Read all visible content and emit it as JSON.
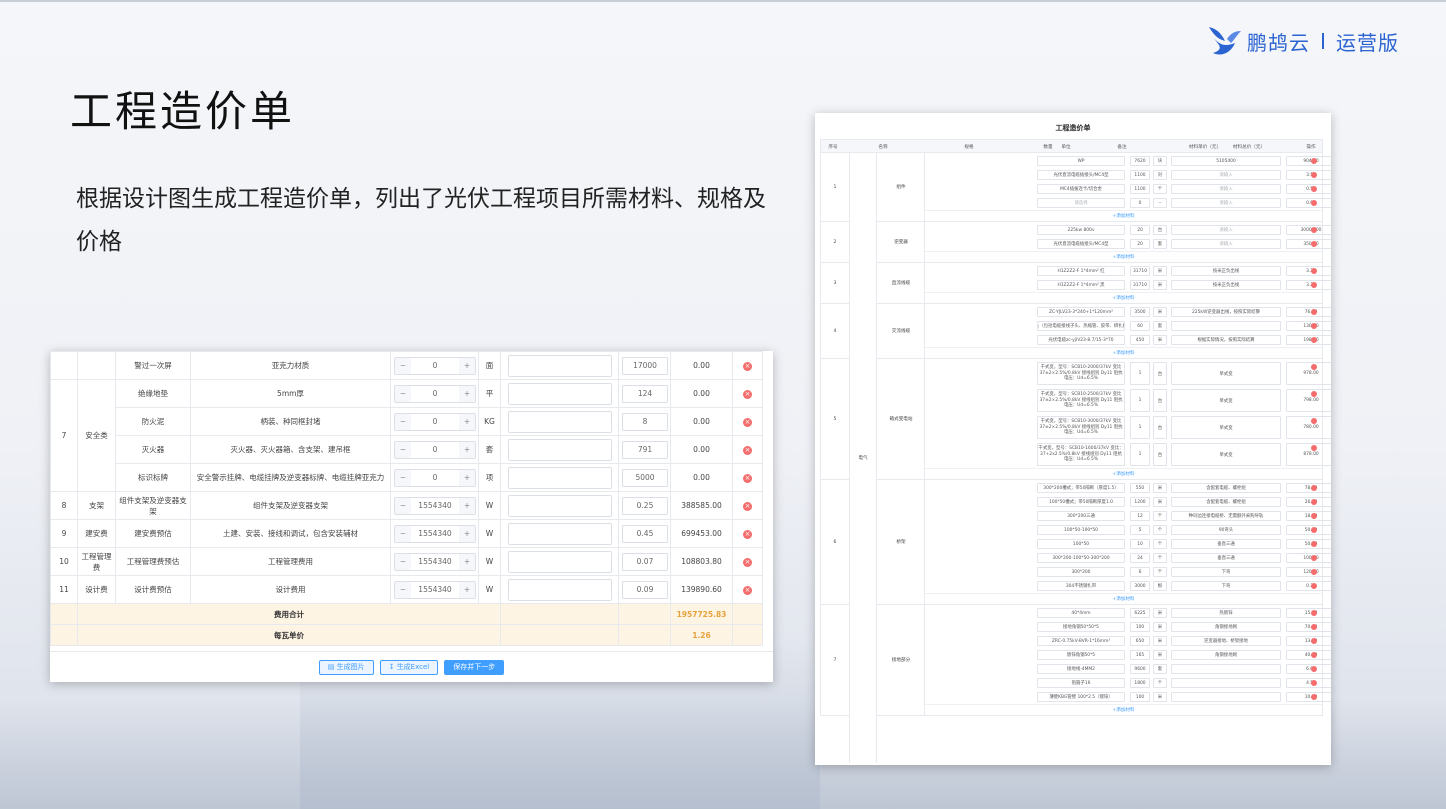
{
  "brand": {
    "name": "鹏鸪云",
    "edition": "运营版",
    "color": "#2b63d0"
  },
  "page": {
    "title": "工程造价单",
    "description": "根据设计图生成工程造价单，列出了光伏工程项目所需材料、规格及价格"
  },
  "left_table": {
    "rows": [
      {
        "idx": "",
        "group": "",
        "name": "警过一次屏",
        "spec": "亚克力材质",
        "qty": "0",
        "unit": "面",
        "price": "17000",
        "total": "0.00"
      },
      {
        "idx": "7",
        "group": "安全类",
        "name": "绝缘地垫",
        "spec": "5mm厚",
        "qty": "0",
        "unit": "平",
        "price": "124",
        "total": "0.00"
      },
      {
        "idx": "",
        "group": "",
        "name": "防火泥",
        "spec": "柄装、种同框封堵",
        "qty": "0",
        "unit": "KG",
        "price": "8",
        "total": "0.00"
      },
      {
        "idx": "",
        "group": "",
        "name": "灭火器",
        "spec": "灭火器、灭火器箱、含支架、建吊框",
        "qty": "0",
        "unit": "套",
        "price": "791",
        "total": "0.00"
      },
      {
        "idx": "",
        "group": "",
        "name": "标识标牌",
        "spec": "安全警示挂牌、电缆挂牌及逆变器标牌、电缆挂牌亚克力",
        "qty": "0",
        "unit": "项",
        "price": "5000",
        "total": "0.00"
      },
      {
        "idx": "8",
        "group": "支架",
        "name": "组件支架及逆变器支架",
        "spec": "组件支架及逆变器支架",
        "qty": "1554340",
        "unit": "W",
        "price": "0.25",
        "total": "388585.00"
      },
      {
        "idx": "9",
        "group": "建安费",
        "name": "建安费预估",
        "spec": "土建、安装、接线和调试，包含安装辅材",
        "qty": "1554340",
        "unit": "W",
        "price": "0.45",
        "total": "699453.00"
      },
      {
        "idx": "10",
        "group": "工程管理费",
        "name": "工程管理费预估",
        "spec": "工程管理费用",
        "qty": "1554340",
        "unit": "W",
        "price": "0.07",
        "total": "108803.80"
      },
      {
        "idx": "11",
        "group": "设计费",
        "name": "设计费预估",
        "spec": "设计费用",
        "qty": "1554340",
        "unit": "W",
        "price": "0.09",
        "total": "139890.60"
      }
    ],
    "summary": [
      {
        "label": "费用合计",
        "value": "1957725.83"
      },
      {
        "label": "每瓦单价",
        "value": "1.26"
      }
    ],
    "buttons": {
      "image": "生成图片",
      "excel": "生成Excel",
      "next": "保存并下一步"
    }
  },
  "right_table": {
    "title": "工程造价单",
    "headers": [
      "序号",
      "名称",
      "规格",
      "数量",
      "单位",
      "备注",
      "材料单价（元）",
      "材料总价（元）",
      "操作"
    ],
    "category": "电气",
    "add_label": "+添加材料",
    "groups": [
      {
        "idx": "1",
        "name": "组件",
        "items": [
          {
            "spec": "WP",
            "qty": "7620",
            "unit": "块",
            "note": "5105400",
            "price": "904.50",
            "total": "6892290.00"
          },
          {
            "spec": "光伏直流电缆插接头/MC4型",
            "qty": "1100",
            "unit": "对",
            "note": "请输入",
            "price": "3.50",
            "total": "3850.00"
          },
          {
            "spec": "MC4插拔连卡/切合金",
            "qty": "1100",
            "unit": "个",
            "note": "请输入",
            "price": "0.50",
            "total": "550.00"
          },
          {
            "spec": "请选择",
            "qty": "0",
            "unit": "--",
            "note": "请输入",
            "price": "0.00",
            "total": "0.00"
          }
        ]
      },
      {
        "idx": "2",
        "name": "逆变器",
        "items": [
          {
            "spec": "225kw 800v",
            "qty": "20",
            "unit": "台",
            "note": "请输入",
            "price": "30000.00",
            "total": "600000.00"
          },
          {
            "spec": "光伏直流电缆插接头/MC4型",
            "qty": "20",
            "unit": "套",
            "note": "请输入",
            "price": "350.00",
            "total": "7000.00"
          }
        ]
      },
      {
        "idx": "3",
        "name": "直流线缆",
        "items": [
          {
            "spec": "H1Z2Z2-F 1*4mm² 红",
            "qty": "31710",
            "unit": "米",
            "note": "按米正负出线",
            "price": "3.25",
            "total": "103057.50"
          },
          {
            "spec": "H1Z2Z2-F 1*4mm² 黑",
            "qty": "31710",
            "unit": "米",
            "note": "按米正负出线",
            "price": "3.25",
            "total": "103057.50"
          }
        ]
      },
      {
        "idx": "4",
        "name": "交流线缆",
        "items": [
          {
            "spec": "ZC-YJLV23-3*240+1*120mm²",
            "qty": "3500",
            "unit": "米",
            "note": "225kW逆变器出线，按照实际结算",
            "price": "76.00",
            "total": "266000.00"
          },
          {
            "spec": "电缆头（包括电缆接线子头、热缩管、胶带、绑扎扣等）",
            "qty": "60",
            "unit": "套",
            "note": "",
            "price": "130.00",
            "total": "7800.00"
          },
          {
            "spec": "光伏电缆zc-yjlV23-8.7/15-3*70",
            "qty": "450",
            "unit": "米",
            "note": "根据实际情况，按照实际结算",
            "price": "198.00",
            "total": "89100.00"
          }
        ]
      },
      {
        "idx": "5",
        "name": "箱式变电站",
        "items": [
          {
            "spec": "干式变，型号：SCB10-2000/37kV 变比37±2×2.5%/0.8kV 接线组别 Dy11 阻抗电压：Ud=6.5%",
            "qty": "1",
            "unit": "台",
            "note": "单式变",
            "price": "978.00",
            "total": "978.00"
          },
          {
            "spec": "干式变，型号：SCB10-2500/37kV 变比37±2×2.5%/0.8kV 接线组别 Dy11 阻抗电压：Ud=6.5%",
            "qty": "1",
            "unit": "台",
            "note": "单式变",
            "price": "798.00",
            "total": "798.00"
          },
          {
            "spec": "干式变，型号：SCB10-3000/37kV 变比37±2×2.5%/0.8kV 接线组别 Dy11 阻抗电压：Ud=6.5%",
            "qty": "1",
            "unit": "台",
            "note": "单式变",
            "price": "780.00",
            "total": "780.00"
          },
          {
            "spec": "干式变，型号：SCB10-1600/37kV 变比：37+2x2.5%/0.8kV 接线组别 Dy11 阻抗电压：Ud=6.5%",
            "qty": "1",
            "unit": "台",
            "note": "单式变",
            "price": "878.00",
            "total": "878.00"
          }
        ]
      },
      {
        "idx": "6",
        "name": "桥架",
        "items": [
          {
            "spec": "300*200槽式；带50隔断（厚度1.5）",
            "qty": "550",
            "unit": "米",
            "note": "含配套电缆、螺栓组",
            "price": "78.00",
            "total": "42900.00"
          },
          {
            "spec": "100*50槽式；带50隔断厚度1.0",
            "qty": "1200",
            "unit": "米",
            "note": "含配套电缆、螺栓组",
            "price": "26.00",
            "total": "31200.00"
          },
          {
            "spec": "300*200三通",
            "qty": "12",
            "unit": "个",
            "note": "种同边连接电缆桥、无需额外采购导轨",
            "price": "18.00",
            "total": "216.00"
          },
          {
            "spec": "100*50-100*50",
            "qty": "5",
            "unit": "个",
            "note": "90弯头",
            "price": "50.00",
            "total": "250.00"
          },
          {
            "spec": "100*50",
            "qty": "10",
            "unit": "个",
            "note": "垂直三通",
            "price": "50.00",
            "total": "500.00"
          },
          {
            "spec": "300*200-100*50-300*200",
            "qty": "24",
            "unit": "个",
            "note": "垂直三通",
            "price": "100.00",
            "total": "2400.00"
          },
          {
            "spec": "300*200",
            "qty": "6",
            "unit": "个",
            "note": "下弯",
            "price": "120.00",
            "total": "720.00"
          },
          {
            "spec": "304不锈钢扎带",
            "qty": "3000",
            "unit": "根",
            "note": "下弯",
            "price": "0.30",
            "total": "900.00"
          }
        ]
      },
      {
        "idx": "7",
        "name": "接地部分",
        "items": [
          {
            "spec": "40*4mm",
            "qty": "6225",
            "unit": "米",
            "note": "热镀锌",
            "price": "15.00",
            "total": "93375.00"
          },
          {
            "spec": "接地角钢50*50*5",
            "qty": "100",
            "unit": "米",
            "note": "角钢接地网",
            "price": "70.00",
            "total": "7000.00"
          },
          {
            "spec": "ZRC-0.75kV-BVR-1*16mm²",
            "qty": "650",
            "unit": "米",
            "note": "逆变器接地、桥架接地",
            "price": "13.00",
            "total": "8450.00"
          },
          {
            "spec": "镀锌角钢50*5",
            "qty": "165",
            "unit": "米",
            "note": "角钢接地网",
            "price": "40.00",
            "total": "6600.00"
          },
          {
            "spec": "接地线-4MM2",
            "qty": "9600",
            "unit": "套",
            "note": "",
            "price": "6.00",
            "total": "57600.00"
          },
          {
            "spec": "抱箍子16",
            "qty": "1800",
            "unit": "个",
            "note": "",
            "price": "4.50",
            "total": "8100.00"
          },
          {
            "spec": "薄壁KBG管壁 100*2.5（镀锌）",
            "qty": "100",
            "unit": "米",
            "note": "",
            "price": "10.00",
            "total": "1000.00"
          }
        ]
      }
    ]
  }
}
